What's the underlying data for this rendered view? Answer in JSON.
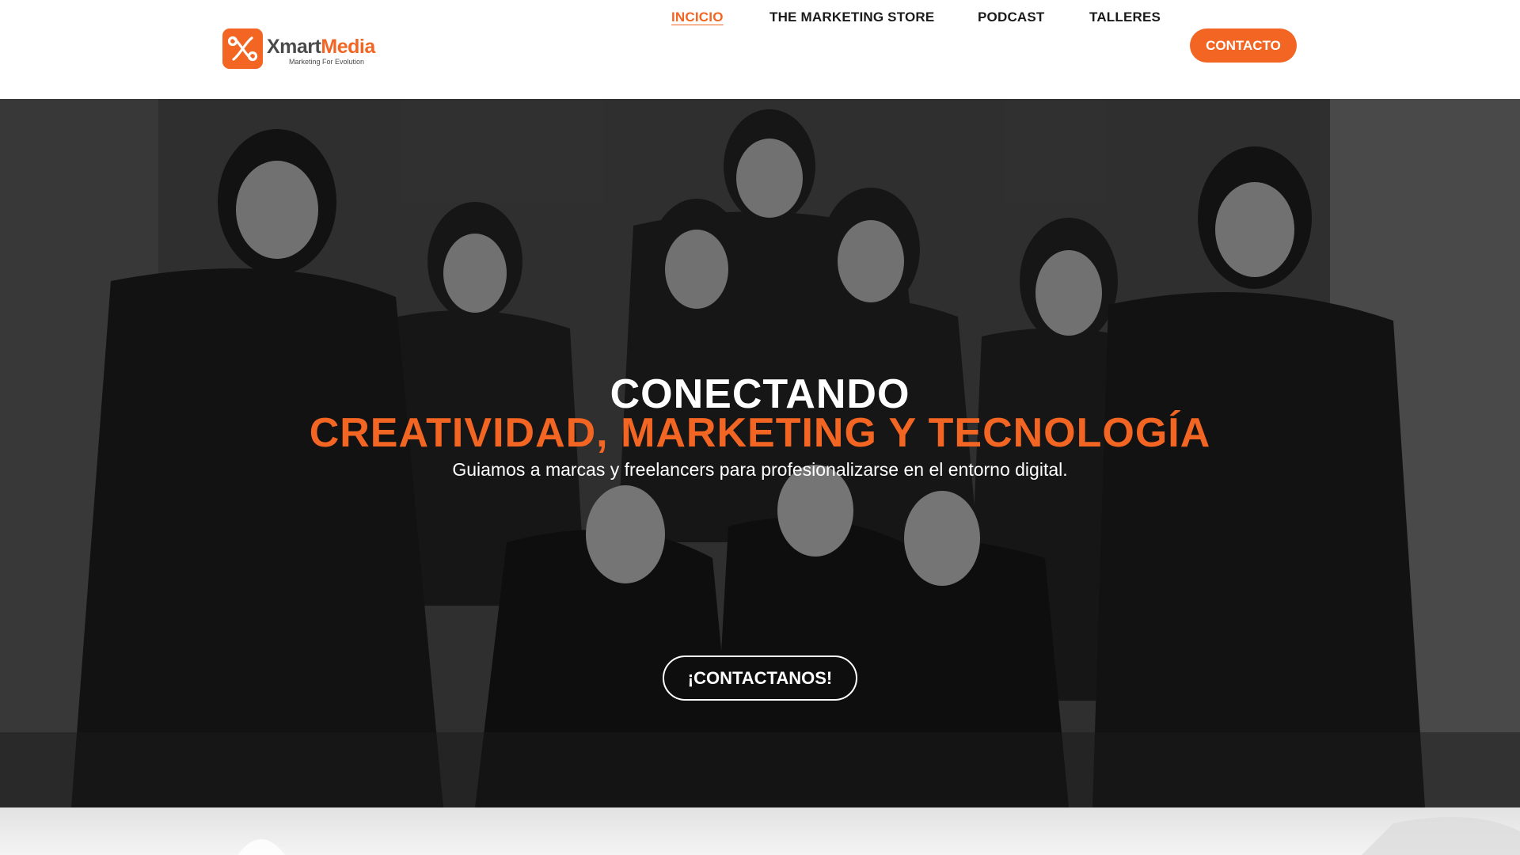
{
  "brand": {
    "name_part1": "Xmart",
    "name_part2": "Media",
    "tagline": "Marketing For Evolution",
    "accent": "#f26522"
  },
  "nav": {
    "items": [
      {
        "label": "INCICIO",
        "active": true
      },
      {
        "label": "THE MARKETING STORE",
        "active": false
      },
      {
        "label": "PODCAST",
        "active": false
      },
      {
        "label": "TALLERES",
        "active": false
      }
    ],
    "cta_label": "CONTACTO"
  },
  "hero": {
    "headline_line1": "CONECTANDO",
    "headline_line2": "CREATIVIDAD, MARKETING Y TECNOLOGÍA",
    "subtitle": "Guiamos a marcas y freelancers para profesionalizarse en el entorno digital.",
    "button_label": "¡CONTACTANOS!"
  }
}
